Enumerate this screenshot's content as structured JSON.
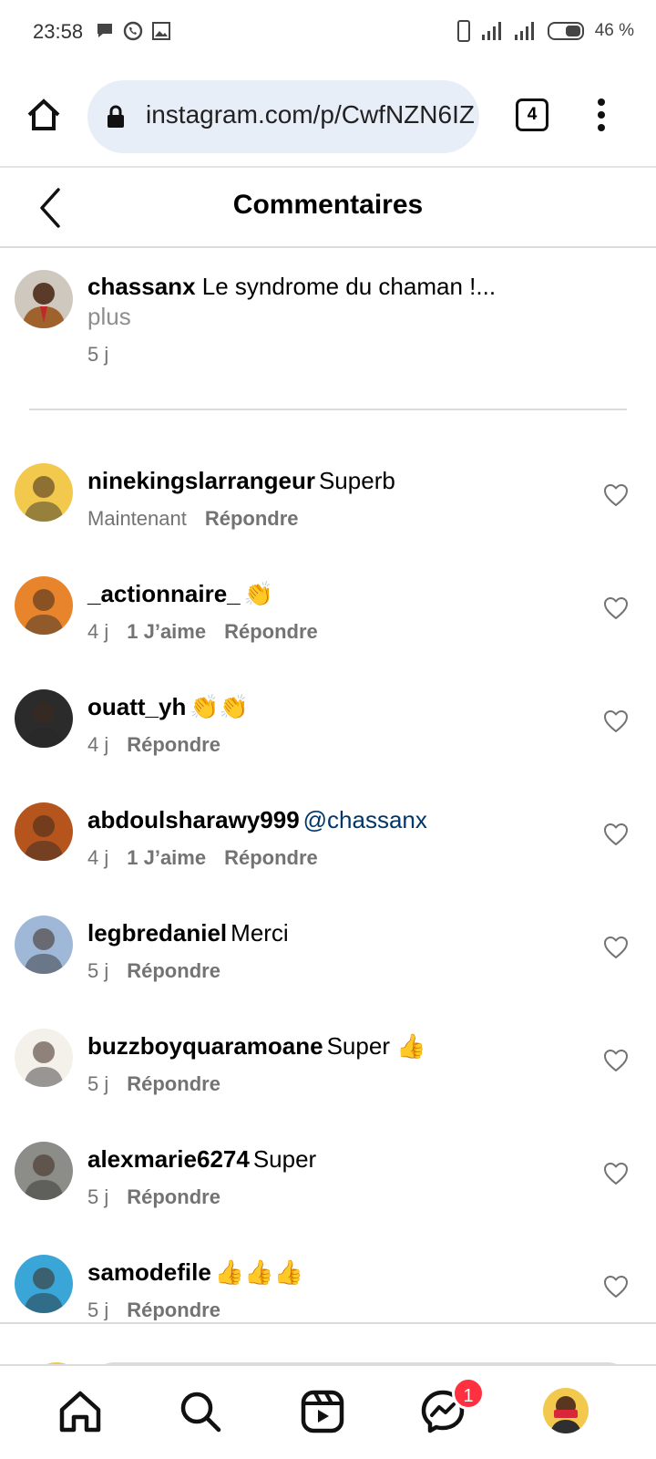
{
  "status_bar": {
    "time": "23:58",
    "battery": "46 %",
    "left_icons": [
      "message-icon",
      "whatsapp-icon",
      "image-icon"
    ],
    "right_icons": [
      "phone-icon",
      "signal-icon",
      "signal-icon",
      "battery-icon"
    ]
  },
  "browser": {
    "url": "instagram.com/p/CwfNZN6IZ",
    "tab_count": "4"
  },
  "header": {
    "title": "Commentaires"
  },
  "caption": {
    "username": "chassanx",
    "text": "Le syndrome du chaman !...",
    "more": "plus",
    "time": "5 j"
  },
  "comments": [
    {
      "username": "ninekingslarrangeur",
      "text": "Superb",
      "time": "Maintenant",
      "likes": "",
      "reply": "Répondre",
      "avatar_color": "#f2c94c"
    },
    {
      "username": "_actionnaire_",
      "text": "👏",
      "time": "4 j",
      "likes": "1 J’aime",
      "reply": "Répondre",
      "avatar_color": "#e8842c"
    },
    {
      "username": "ouatt_yh",
      "text": "👏👏",
      "time": "4 j",
      "likes": "",
      "reply": "Répondre",
      "avatar_color": "#2b2b2b"
    },
    {
      "username": "abdoulsharawy999",
      "text": "@chassanx",
      "mention": true,
      "time": "4 j",
      "likes": "1 J’aime",
      "reply": "Répondre",
      "avatar_color": "#b5551d"
    },
    {
      "username": "legbredaniel",
      "text": "Merci",
      "time": "5 j",
      "likes": "",
      "reply": "Répondre",
      "avatar_color": "#9fb8d8"
    },
    {
      "username": "buzzboyquaramoane",
      "text": "Super 👍",
      "time": "5 j",
      "likes": "",
      "reply": "Répondre",
      "avatar_color": "#f4f0ea"
    },
    {
      "username": "alexmarie6274",
      "text": "Super",
      "time": "5 j",
      "likes": "",
      "reply": "Répondre",
      "avatar_color": "#8c8c88"
    },
    {
      "username": "samodefile",
      "text": "👍👍👍",
      "time": "5 j",
      "likes": "",
      "reply": "Répondre",
      "avatar_color": "#3aa6d8"
    }
  ],
  "nav": {
    "items": [
      "home-icon",
      "search-icon",
      "reels-icon",
      "messenger-icon",
      "profile-avatar"
    ],
    "messages_badge": "1"
  },
  "colors": {
    "accent": "#ff3040",
    "mention": "#00376b",
    "muted": "#737373",
    "url_pill": "#e8eef8"
  }
}
